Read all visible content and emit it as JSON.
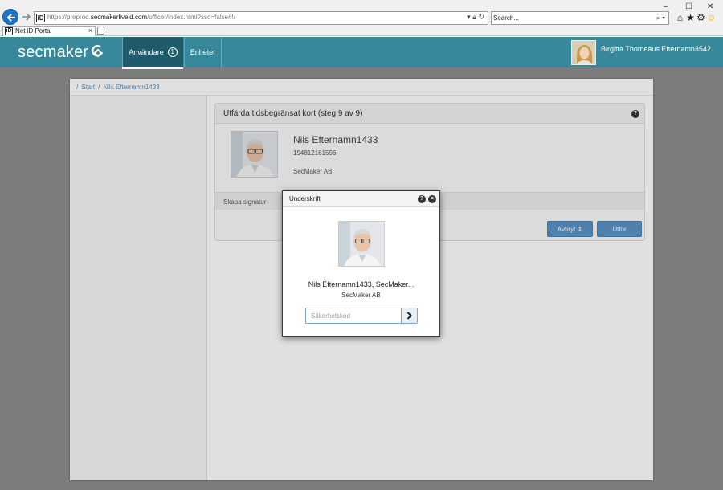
{
  "browser": {
    "url_prefix": "https://preprod.",
    "url_domain": "secmakerliveid.com",
    "url_path": "/officer/index.html?sso=false#!/",
    "search_placeholder": "Search...",
    "tab_title": "Net iD Portal",
    "window_controls": {
      "minimize": "–",
      "maximize": "☐",
      "close": "✕"
    }
  },
  "header": {
    "brand": "secmaker",
    "nav": {
      "users_label": "Användare",
      "users_count": "1",
      "units_label": "Enheter"
    },
    "user_name": "Birgitta Thomeaus Efternamn3542"
  },
  "breadcrumb": {
    "start": "Start",
    "current": "Nils Efternamn1433"
  },
  "card": {
    "title": "Utfärda tidsbegränsat kort (steg 9 av 9)",
    "person_name": "Nils Efternamn1433",
    "person_id": "194812161596",
    "person_org": "SecMaker AB",
    "signature_label": "Skapa signatur",
    "cancel_label": "Avbryt",
    "submit_label": "Utför"
  },
  "modal": {
    "title": "Underskrift",
    "name": "Nils Efternamn1433, SecMaker...",
    "org": "SecMaker AB",
    "code_placeholder": "Säkerhetskod"
  },
  "colors": {
    "header_teal": "#38889b",
    "nav_active": "#1f5b6a",
    "button_blue": "#5b93c8",
    "link_blue": "#5d8fb8"
  }
}
